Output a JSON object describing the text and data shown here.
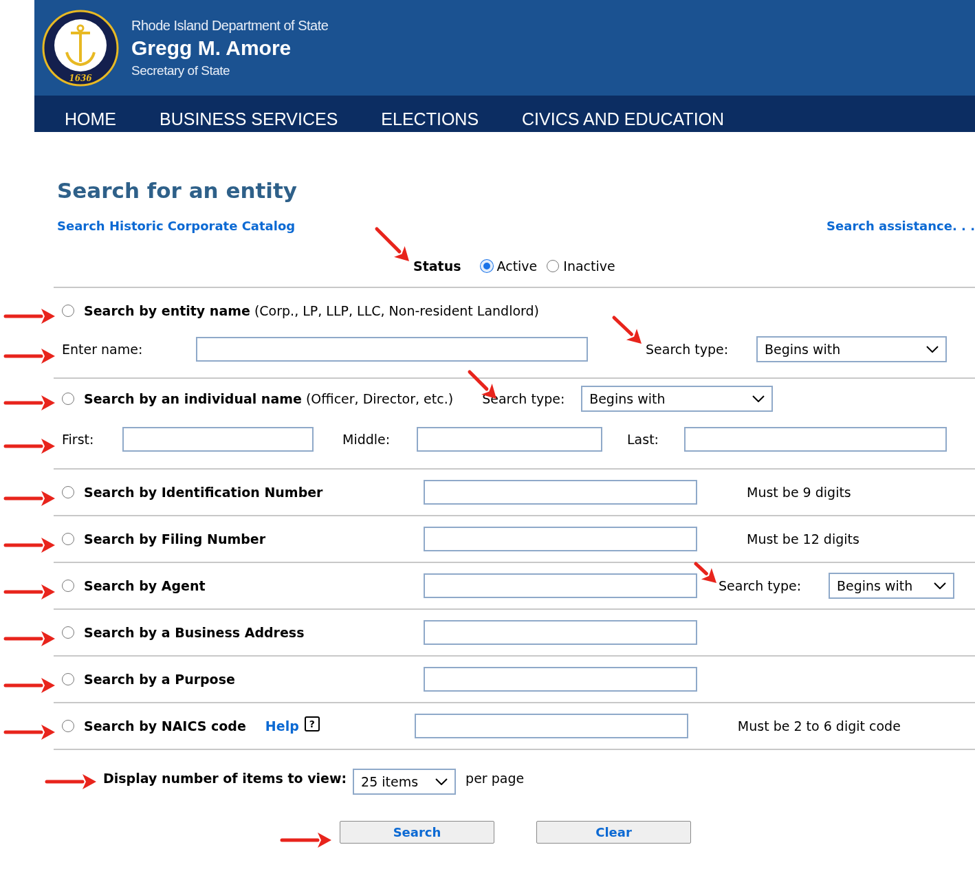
{
  "header": {
    "department": "Rhode Island Department of State",
    "name": "Gregg M. Amore",
    "title": "Secretary of State",
    "seal_year": "1636"
  },
  "nav": [
    "HOME",
    "BUSINESS SERVICES",
    "ELECTIONS",
    "CIVICS AND EDUCATION"
  ],
  "page_title": "Search for an entity",
  "links": {
    "historic": "Search Historic Corporate Catalog",
    "assistance": "Search assistance. . ."
  },
  "status": {
    "label": "Status",
    "options": [
      {
        "label": "Active",
        "selected": true
      },
      {
        "label": "Inactive",
        "selected": false
      }
    ]
  },
  "search_options": [
    {
      "kind": "entity",
      "selected": false,
      "label": "Search by entity name",
      "note": "(Corp., LP, LLP, LLC, Non-resident Landlord)",
      "field_label": "Enter name:",
      "search_type_label": "Search type:",
      "search_type": "Begins with"
    },
    {
      "kind": "individual",
      "selected": false,
      "label": "Search by an individual name",
      "note": "(Officer, Director, etc.)",
      "search_type_label": "Search type:",
      "search_type": "Begins with",
      "name_fields": [
        "First:",
        "Middle:",
        "Last:"
      ]
    },
    {
      "kind": "simple",
      "selected": false,
      "label": "Search by Identification Number",
      "hint": "Must be 9 digits"
    },
    {
      "kind": "simple",
      "selected": false,
      "label": "Search by Filing Number",
      "hint": "Must be 12 digits"
    },
    {
      "kind": "simple",
      "selected": false,
      "label": "Search by Agent",
      "search_type_label": "Search type:",
      "search_type": "Begins with"
    },
    {
      "kind": "simple",
      "selected": false,
      "label": "Search by a Business Address"
    },
    {
      "kind": "simple",
      "selected": false,
      "label": "Search by a Purpose"
    },
    {
      "kind": "simple",
      "selected": false,
      "label": "Search by NAICS code",
      "help_link": "Help",
      "help_icon": "?",
      "hint": "Must be 2 to 6 digit code"
    }
  ],
  "display": {
    "label": "Display number of items to view:",
    "value": "25 items",
    "suffix": "per page"
  },
  "buttons": [
    "Search",
    "Clear"
  ]
}
